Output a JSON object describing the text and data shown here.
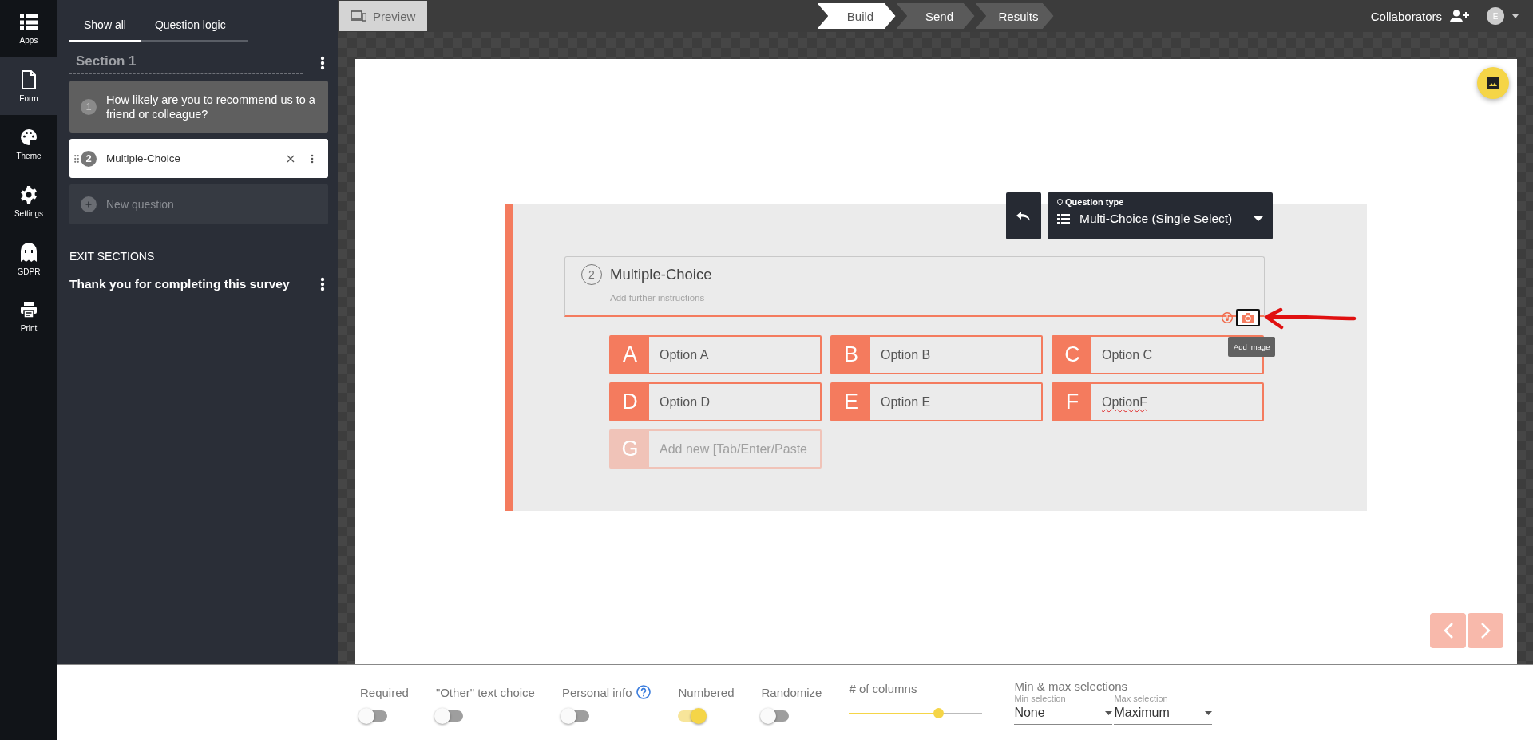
{
  "rail": [
    {
      "label": "Apps",
      "kind": "apps",
      "selected": false
    },
    {
      "label": "Form",
      "kind": "form",
      "selected": true
    },
    {
      "label": "Theme",
      "kind": "theme",
      "selected": false
    },
    {
      "label": "Settings",
      "kind": "settings",
      "selected": false
    },
    {
      "label": "GDPR",
      "kind": "gdpr",
      "selected": false
    },
    {
      "label": "Print",
      "kind": "print",
      "selected": false
    }
  ],
  "sidebar": {
    "tabs": [
      {
        "label": "Show all",
        "selected": true
      },
      {
        "label": "Question logic",
        "selected": false
      }
    ],
    "section": {
      "title": "Section 1"
    },
    "questions": [
      {
        "number": "1",
        "text": "How likely are you to recommend us to a friend or colleague?",
        "selected": false
      },
      {
        "number": "2",
        "text": "Multiple-Choice",
        "selected": true
      }
    ],
    "new_question": "New question",
    "exit_heading": "EXIT SECTIONS",
    "exit_sections": [
      "Thank you for completing this survey"
    ]
  },
  "topbar": {
    "preview": "Preview",
    "steps": [
      {
        "label": "Build",
        "selected": true
      },
      {
        "label": "Send",
        "selected": false
      },
      {
        "label": "Results",
        "selected": false
      }
    ],
    "collaborators": "Collaborators",
    "avatar": "E"
  },
  "question": {
    "type_label": "Question type",
    "type": "Multi-Choice (Single Select)",
    "number": "2",
    "title": "Multiple-Choice",
    "instructions_placeholder": "Add further instructions",
    "tooltip": "Add image",
    "options": [
      {
        "letter": "A",
        "text": "Option A",
        "misspelled": false
      },
      {
        "letter": "B",
        "text": "Option B",
        "misspelled": false
      },
      {
        "letter": "C",
        "text": "Option C",
        "misspelled": false
      },
      {
        "letter": "D",
        "text": "Option D",
        "misspelled": false
      },
      {
        "letter": "E",
        "text": "Option E",
        "misspelled": false
      },
      {
        "letter": "F",
        "text": "OptionF",
        "misspelled": true
      }
    ],
    "new_option": {
      "letter": "G",
      "placeholder": "Add new [Tab/Enter/Paste"
    }
  },
  "settings": {
    "toggles": [
      {
        "label": "Required",
        "on": false,
        "help": false
      },
      {
        "label": "\"Other\" text choice",
        "on": false,
        "help": false
      },
      {
        "label": "Personal info",
        "on": false,
        "help": true
      },
      {
        "label": "Numbered",
        "on": true,
        "help": false
      },
      {
        "label": "Randomize",
        "on": false,
        "help": false
      }
    ],
    "columns": {
      "label": "# of columns",
      "level": 0.67
    },
    "selections": {
      "title": "Min & max selections",
      "min": {
        "label": "Min selection",
        "value": "None"
      },
      "max": {
        "label": "Max selection",
        "value": "Maximum"
      }
    }
  }
}
